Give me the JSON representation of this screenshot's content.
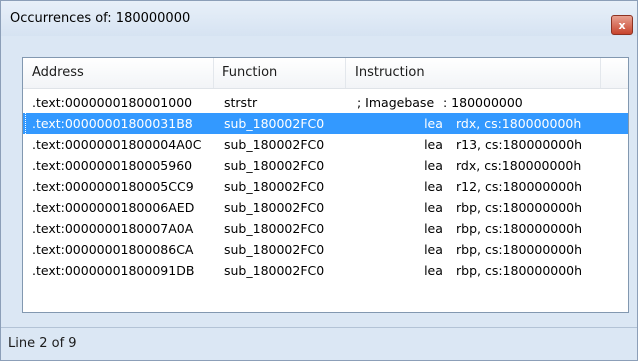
{
  "window": {
    "title": "Occurrences of: 180000000",
    "close_label": "x"
  },
  "columns": {
    "address": "Address",
    "function": "Function",
    "instruction": "Instruction"
  },
  "rows": [
    {
      "address": ".text:0000000180001000",
      "function": "strstr",
      "semicolon": "; Imagebase",
      "immediate": ": 180000000",
      "mnemonic": "",
      "operand": ""
    },
    {
      "address": ".text:00000001800031B8",
      "function": "sub_180002FC0",
      "mnemonic": "lea",
      "operand": "rdx, cs:180000000h"
    },
    {
      "address": ".text:00000001800004A0C",
      "function": "sub_180002FC0",
      "mnemonic": "lea",
      "operand": "r13, cs:180000000h"
    },
    {
      "address": ".text:0000000180005960",
      "function": "sub_180002FC0",
      "mnemonic": "lea",
      "operand": "rdx, cs:180000000h"
    },
    {
      "address": ".text:0000000180005CC9",
      "function": "sub_180002FC0",
      "mnemonic": "lea",
      "operand": "r12, cs:180000000h"
    },
    {
      "address": ".text:0000000180006AED",
      "function": "sub_180002FC0",
      "mnemonic": "lea",
      "operand": "rbp, cs:180000000h"
    },
    {
      "address": ".text:0000000180007A0A",
      "function": "sub_180002FC0",
      "mnemonic": "lea",
      "operand": "rbp, cs:180000000h"
    },
    {
      "address": ".text:00000001800086CA",
      "function": "sub_180002FC0",
      "mnemonic": "lea",
      "operand": "rbp, cs:180000000h"
    },
    {
      "address": ".text:00000001800091DB",
      "function": "sub_180002FC0",
      "mnemonic": "lea",
      "operand": "rbp, cs:180000000h"
    }
  ],
  "selected_index": 1,
  "status": "Line 2 of 9"
}
